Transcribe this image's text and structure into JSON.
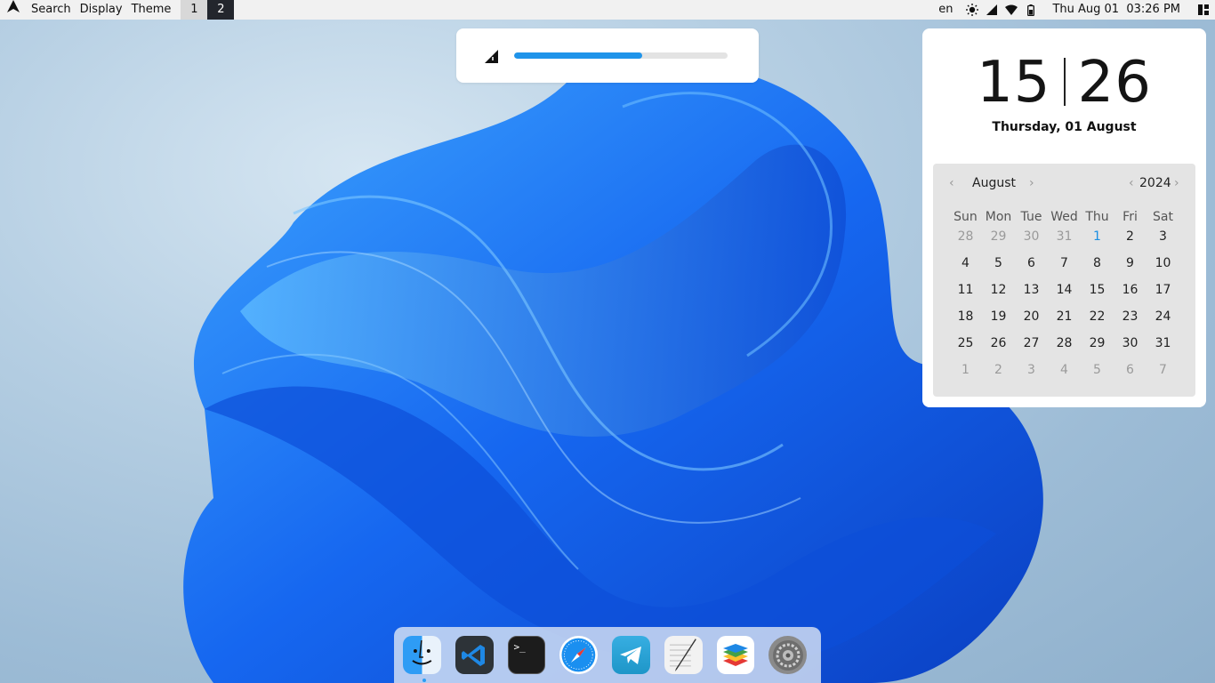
{
  "topbar": {
    "logo_icon": "arch-logo-icon",
    "menu": [
      "Search",
      "Display",
      "Theme"
    ],
    "workspaces": [
      "1",
      "2"
    ],
    "active_workspace": "2",
    "language": "en",
    "status_icons": [
      "brightness-icon",
      "signal-icon",
      "wifi-icon",
      "battery-icon"
    ],
    "datetime": "Thu Aug 01  03:26 PM",
    "panel_icon": "panel-toggle-icon"
  },
  "osd": {
    "icon": "signal-icon",
    "level_percent": 60
  },
  "clock": {
    "hours": "15",
    "minutes": "26",
    "date_line": "Thursday, 01 August"
  },
  "calendar": {
    "month": "August",
    "year": "2024",
    "weekdays": [
      "Sun",
      "Mon",
      "Tue",
      "Wed",
      "Thu",
      "Fri",
      "Sat"
    ],
    "days": [
      [
        "28",
        "29",
        "30",
        "31",
        "1",
        "2",
        "3"
      ],
      [
        "4",
        "5",
        "6",
        "7",
        "8",
        "9",
        "10"
      ],
      [
        "11",
        "12",
        "13",
        "14",
        "15",
        "16",
        "17"
      ],
      [
        "18",
        "19",
        "20",
        "21",
        "22",
        "23",
        "24"
      ],
      [
        "25",
        "26",
        "27",
        "28",
        "29",
        "30",
        "31"
      ],
      [
        "1",
        "2",
        "3",
        "4",
        "5",
        "6",
        "7"
      ]
    ],
    "today": "1",
    "colors": {
      "today": "#1a8fe3",
      "accent": "#1f94ea"
    }
  },
  "dock": {
    "apps": [
      {
        "name": "finder-icon"
      },
      {
        "name": "vscode-icon"
      },
      {
        "name": "terminal-icon"
      },
      {
        "name": "safari-icon"
      },
      {
        "name": "telegram-icon"
      },
      {
        "name": "text-editor-icon"
      },
      {
        "name": "layers-icon"
      },
      {
        "name": "system-settings-icon"
      }
    ]
  }
}
